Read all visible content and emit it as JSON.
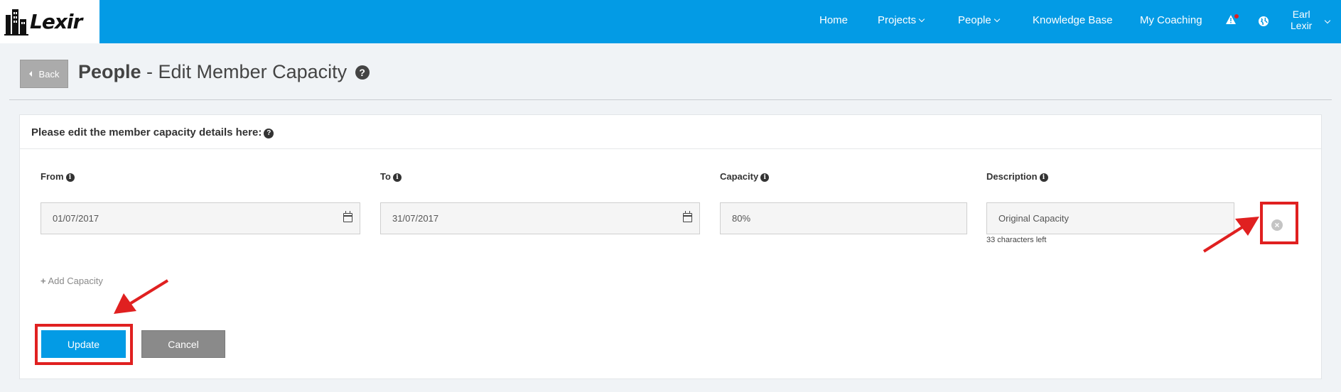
{
  "brand": {
    "name": "Lexir"
  },
  "nav": {
    "items": [
      {
        "label": "Home"
      },
      {
        "label": "Projects"
      },
      {
        "label": "People"
      },
      {
        "label": "Knowledge Base"
      },
      {
        "label": "My Coaching"
      }
    ],
    "user": {
      "first": "Earl",
      "last": "Lexir"
    }
  },
  "header": {
    "back_label": "Back",
    "title_bold": "People",
    "title_rest": " - Edit Member Capacity"
  },
  "form": {
    "prompt": "Please edit the member capacity details here:",
    "labels": {
      "from": "From",
      "to": "To",
      "capacity": "Capacity",
      "description": "Description"
    },
    "values": {
      "from": "01/07/2017",
      "to": "31/07/2017",
      "capacity": "80%",
      "description": "Original Capacity"
    },
    "chars_left": "33 characters left",
    "add_capacity": "Add Capacity",
    "update_label": "Update",
    "cancel_label": "Cancel"
  },
  "colors": {
    "nav_bg": "#039be5",
    "primary": "#039be5",
    "secondary": "#8a8a8a",
    "annotation": "#e02020"
  }
}
